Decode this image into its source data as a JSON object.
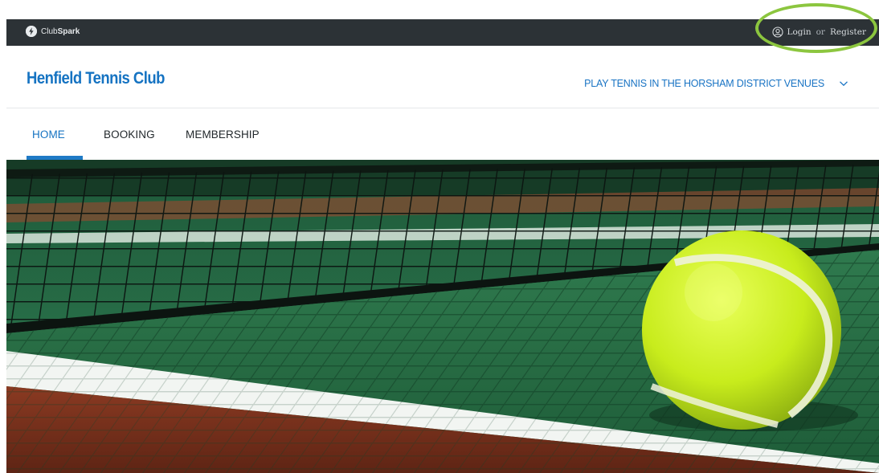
{
  "topbar": {
    "brand": {
      "name_light": "Club",
      "name_bold": "Spark",
      "icon": "lightning-bolt-icon"
    },
    "auth": {
      "icon": "user-circle-icon",
      "login_label": "Login",
      "separator": "or",
      "register_label": "Register"
    }
  },
  "header": {
    "club_name": "Henfield Tennis Club",
    "venues_label": "PLAY TENNIS IN THE HORSHAM DISTRICT VENUES",
    "venues_icon": "chevron-down-icon"
  },
  "nav": {
    "tabs": [
      {
        "label": "HOME",
        "active": true
      },
      {
        "label": "BOOKING",
        "active": false
      },
      {
        "label": "MEMBERSHIP",
        "active": false
      }
    ]
  },
  "colors": {
    "topbar_bg": "#2c3236",
    "brand_blue": "#1573c2",
    "highlight_green": "#8cc63f"
  },
  "hero": {
    "image": "tennis-ball-on-court-by-net"
  }
}
